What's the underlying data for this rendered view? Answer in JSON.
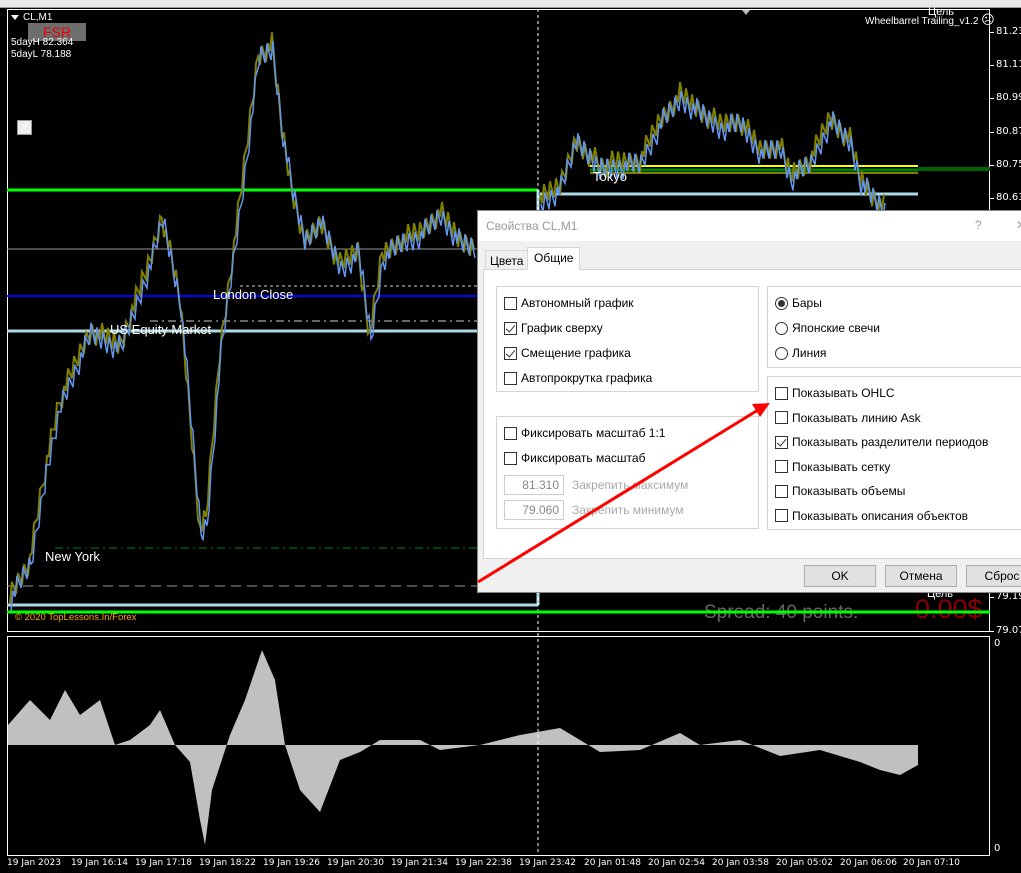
{
  "chart": {
    "symbol": "CL,M1",
    "fsr_label": "FSR",
    "five_day_high": "5dayH 82.364",
    "five_day_low": "5dayL 78.188",
    "v_button": "v",
    "indicator_name": "Wheelbarrel Trailing_v1.2",
    "target_label": "Цель",
    "session_labels": {
      "tokyo": "Tokyo",
      "london": "London Close",
      "us_equity": "US Equity Market",
      "new_york": "New York"
    },
    "copyright": "© 2020 TopLessons.In/Forex",
    "spread_text": "Spread: 40 points.",
    "profit_text": "0.00$",
    "price_axis": [
      "81.230",
      "81.110",
      "80.990",
      "80.870",
      "80.750",
      "80.630",
      "79.190",
      "79.070"
    ],
    "indicator_axis": [
      "0",
      "0"
    ],
    "time_axis": [
      "19 Jan 2023",
      "19 Jan 16:14",
      "19 Jan 17:18",
      "19 Jan 18:22",
      "19 Jan 19:26",
      "19 Jan 20:30",
      "19 Jan 21:34",
      "19 Jan 22:38",
      "19 Jan 23:42",
      "20 Jan 01:48",
      "20 Jan 02:54",
      "20 Jan 03:58",
      "20 Jan 05:02",
      "20 Jan 06:06",
      "20 Jan 07:10"
    ],
    "colors": {
      "bull": "#6495ed",
      "bear": "#808000",
      "green_line": "#00ff00",
      "blue_line": "#0000ff",
      "light_blue": "#add8e6",
      "yellow": "#ffff00",
      "profit": "#8b0000"
    }
  },
  "dialog": {
    "title": "Свойства CL,M1",
    "help": "?",
    "close": "✕",
    "tabs": [
      {
        "label": "Цвета",
        "active": false
      },
      {
        "label": "Общие",
        "active": true
      }
    ],
    "general_options": [
      {
        "label": "Автономный график",
        "checked": false
      },
      {
        "label": "График сверху",
        "checked": true
      },
      {
        "label": "Смещение графика",
        "checked": true
      },
      {
        "label": "Автопрокрутка графика",
        "checked": false
      }
    ],
    "scale_options": [
      {
        "label": "Фиксировать масштаб 1:1",
        "checked": false
      },
      {
        "label": "Фиксировать масштаб",
        "checked": false
      }
    ],
    "fix_max": {
      "value": "81.310",
      "label": "Закрепить максимум"
    },
    "fix_min": {
      "value": "79.060",
      "label": "Закрепить минимум"
    },
    "chart_types": [
      {
        "label": "Бары",
        "selected": true
      },
      {
        "label": "Японские свечи",
        "selected": false
      },
      {
        "label": "Линия",
        "selected": false
      }
    ],
    "show_options": [
      {
        "label": "Показывать OHLC",
        "checked": false
      },
      {
        "label": "Показывать линию Ask",
        "checked": false
      },
      {
        "label": "Показывать разделители периодов",
        "checked": true
      },
      {
        "label": "Показывать сетку",
        "checked": false
      },
      {
        "label": "Показывать объемы",
        "checked": false
      },
      {
        "label": "Показывать описания объектов",
        "checked": false
      }
    ],
    "buttons": {
      "ok": "OK",
      "cancel": "Отмена",
      "reset": "Сброс"
    }
  }
}
